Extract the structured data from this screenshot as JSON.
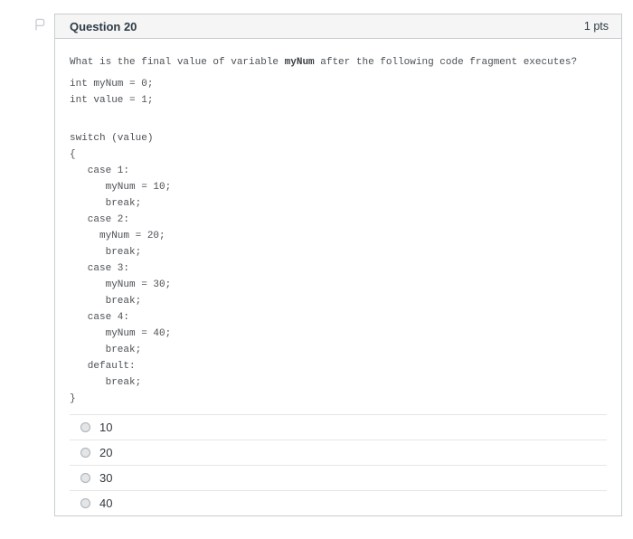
{
  "colors": {
    "card_border": "#c7cdd1",
    "header_bg": "#f5f5f5",
    "header_text": "#2d3b45",
    "code_text": "#4c5055",
    "option_divider": "#e6e6e6",
    "flag_icon": "#c7cdd1"
  },
  "question": {
    "header": {
      "title": "Question 20",
      "points": "1 pts"
    },
    "prompt": {
      "before": "What is the final value of variable ",
      "emphasis": "myNum",
      "after": " after the following code fragment executes?"
    },
    "declaration_lines": [
      "int myNum = 0;",
      "int value = 1;"
    ],
    "switch_lines": [
      "switch (value)",
      "{",
      "   case 1:",
      "      myNum = 10;",
      "      break;",
      "   case 2:",
      "     myNum = 20;",
      "      break;",
      "   case 3:",
      "      myNum = 30;",
      "      break;",
      "   case 4:",
      "      myNum = 40;",
      "      break;",
      "   default:",
      "      break;",
      "}"
    ],
    "options": [
      {
        "label": "10"
      },
      {
        "label": "20"
      },
      {
        "label": "30"
      },
      {
        "label": "40"
      }
    ]
  }
}
